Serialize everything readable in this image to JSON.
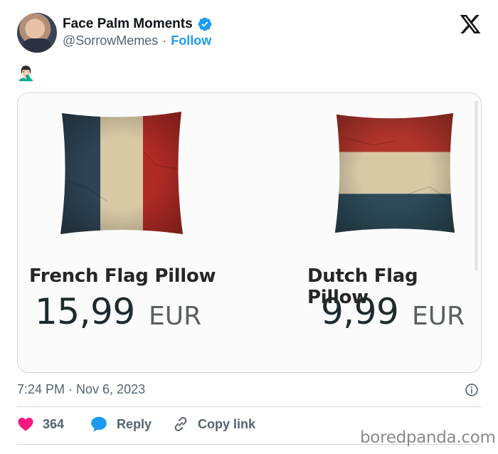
{
  "author": {
    "display_name": "Face Palm Moments",
    "handle": "@SorrowMemes",
    "separator": "·",
    "follow_label": "Follow",
    "verified_color": "#1d9bf0"
  },
  "tweet": {
    "text": "🤦🏻‍♂️",
    "timestamp": "7:24 PM · Nov 6, 2023"
  },
  "media": {
    "items": [
      {
        "title": "French Flag Pillow",
        "price": "15,99",
        "currency": "EUR",
        "stripes": [
          "#2e4353",
          "#d8c9a6",
          "#b02a26"
        ],
        "orientation": "vertical"
      },
      {
        "title": "Dutch Flag Pillow",
        "price": "9,99",
        "currency": "EUR",
        "stripes": [
          "#b0342c",
          "#d8c9a6",
          "#2c4a58"
        ],
        "orientation": "horizontal"
      }
    ]
  },
  "actions": {
    "like_count": "364",
    "reply_label": "Reply",
    "copy_link_label": "Copy link",
    "like_color": "#f91880",
    "reply_color": "#1d9bf0"
  },
  "watermark": "boredpanda.com",
  "icons": [
    "verified-badge-icon",
    "x-logo-icon",
    "info-icon",
    "heart-icon",
    "reply-bubble-icon",
    "link-icon"
  ]
}
